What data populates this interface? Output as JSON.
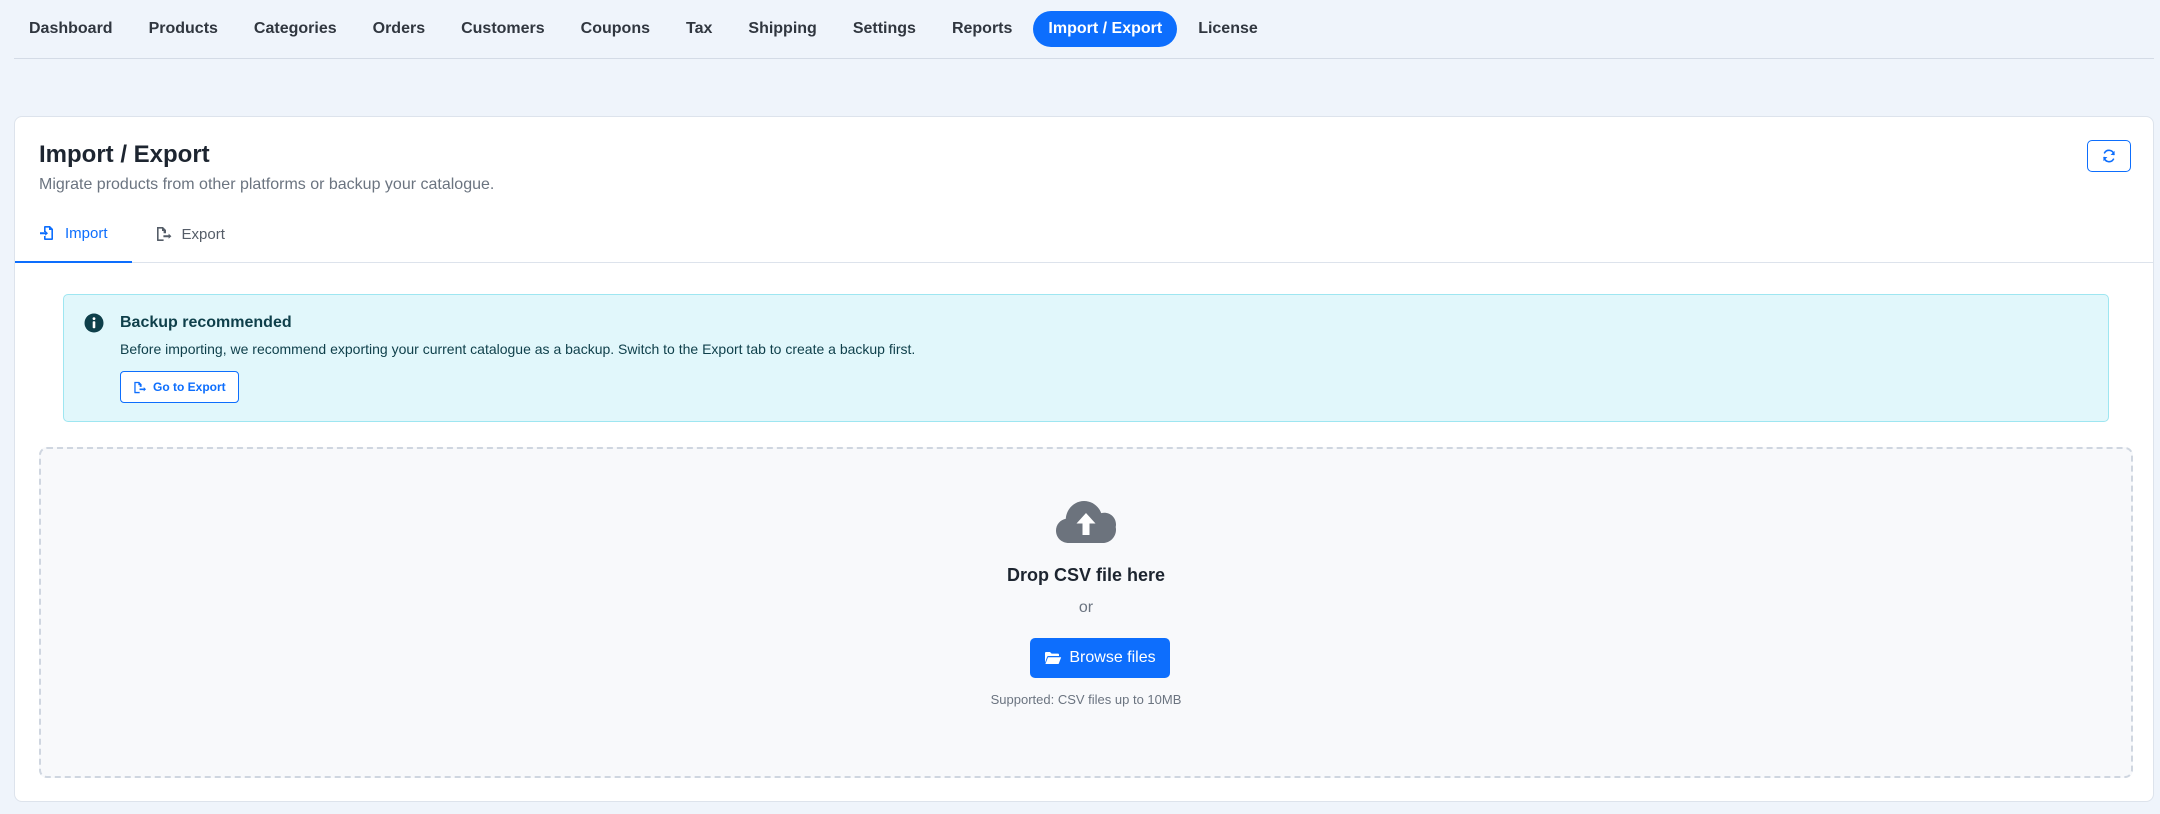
{
  "nav": {
    "items": [
      {
        "label": "Dashboard"
      },
      {
        "label": "Products"
      },
      {
        "label": "Categories"
      },
      {
        "label": "Orders"
      },
      {
        "label": "Customers"
      },
      {
        "label": "Coupons"
      },
      {
        "label": "Tax"
      },
      {
        "label": "Shipping"
      },
      {
        "label": "Settings"
      },
      {
        "label": "Reports"
      },
      {
        "label": "Import / Export",
        "active": true
      },
      {
        "label": "License"
      }
    ]
  },
  "page": {
    "title": "Import / Export",
    "subtitle": "Migrate products from other platforms or backup your catalogue.",
    "refresh_icon": "refresh-icon"
  },
  "tabs": [
    {
      "label": "Import",
      "icon": "file-import-icon",
      "active": true
    },
    {
      "label": "Export",
      "icon": "file-export-icon",
      "active": false
    }
  ],
  "alert": {
    "icon": "info-icon",
    "title": "Backup recommended",
    "text": "Before importing, we recommend exporting your current catalogue as a backup. Switch to the Export tab to create a backup first.",
    "button_label": "Go to Export"
  },
  "dropzone": {
    "icon": "cloud-upload-icon",
    "title": "Drop CSV file here",
    "or_text": "or",
    "browse_label": "Browse files",
    "browse_icon": "folder-open-icon",
    "hint": "Supported: CSV files up to 10MB"
  },
  "colors": {
    "accent": "#0d6efd",
    "background": "#eff4fb",
    "alert_bg": "#e1f7fb",
    "alert_border": "#9ee6f1",
    "alert_text": "#0e3f4a"
  }
}
